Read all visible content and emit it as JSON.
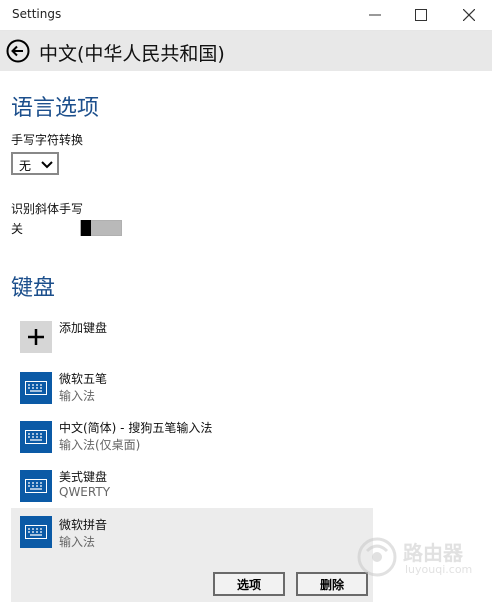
{
  "window": {
    "title": "Settings"
  },
  "header": {
    "title": "中文(中华人民共和国)"
  },
  "language_options": {
    "heading": "语言选项",
    "handwriting_label": "手写字符转换",
    "handwriting_value": "无",
    "italic_label": "识别斜体手写",
    "italic_state": "关",
    "italic_on": false
  },
  "keyboard": {
    "heading": "键盘",
    "add_label": "添加键盘",
    "items": [
      {
        "name": "微软五笔",
        "sub": "输入法"
      },
      {
        "name": "中文(简体) - 搜狗五笔输入法",
        "sub": "输入法(仅桌面)"
      },
      {
        "name": "美式键盘",
        "sub": "QWERTY"
      },
      {
        "name": "微软拼音",
        "sub": "输入法"
      }
    ],
    "options_label": "选项",
    "remove_label": "删除"
  },
  "watermark": {
    "line1": "路由器",
    "line2": "luyouqi.com"
  },
  "colors": {
    "accent": "#1c4f8c",
    "keyboard_icon": "#0b5aa6",
    "header_bg": "#e8e8e8"
  }
}
